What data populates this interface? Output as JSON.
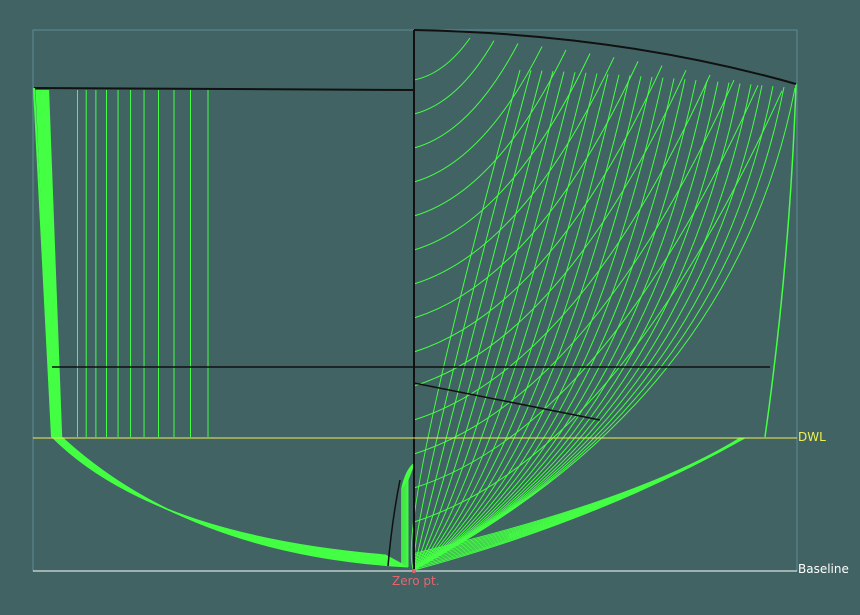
{
  "labels": {
    "dwl": "DWL",
    "baseline": "Baseline",
    "zero_point": "Zero pt."
  },
  "colors": {
    "background": "#416363",
    "frame": "#5f8c94",
    "station_lines": "#44ff44",
    "hull_outline": "#111111",
    "dwl_line": "#f0f050",
    "baseline_line": "#ffffff",
    "zero_point": "#e8646e"
  }
}
